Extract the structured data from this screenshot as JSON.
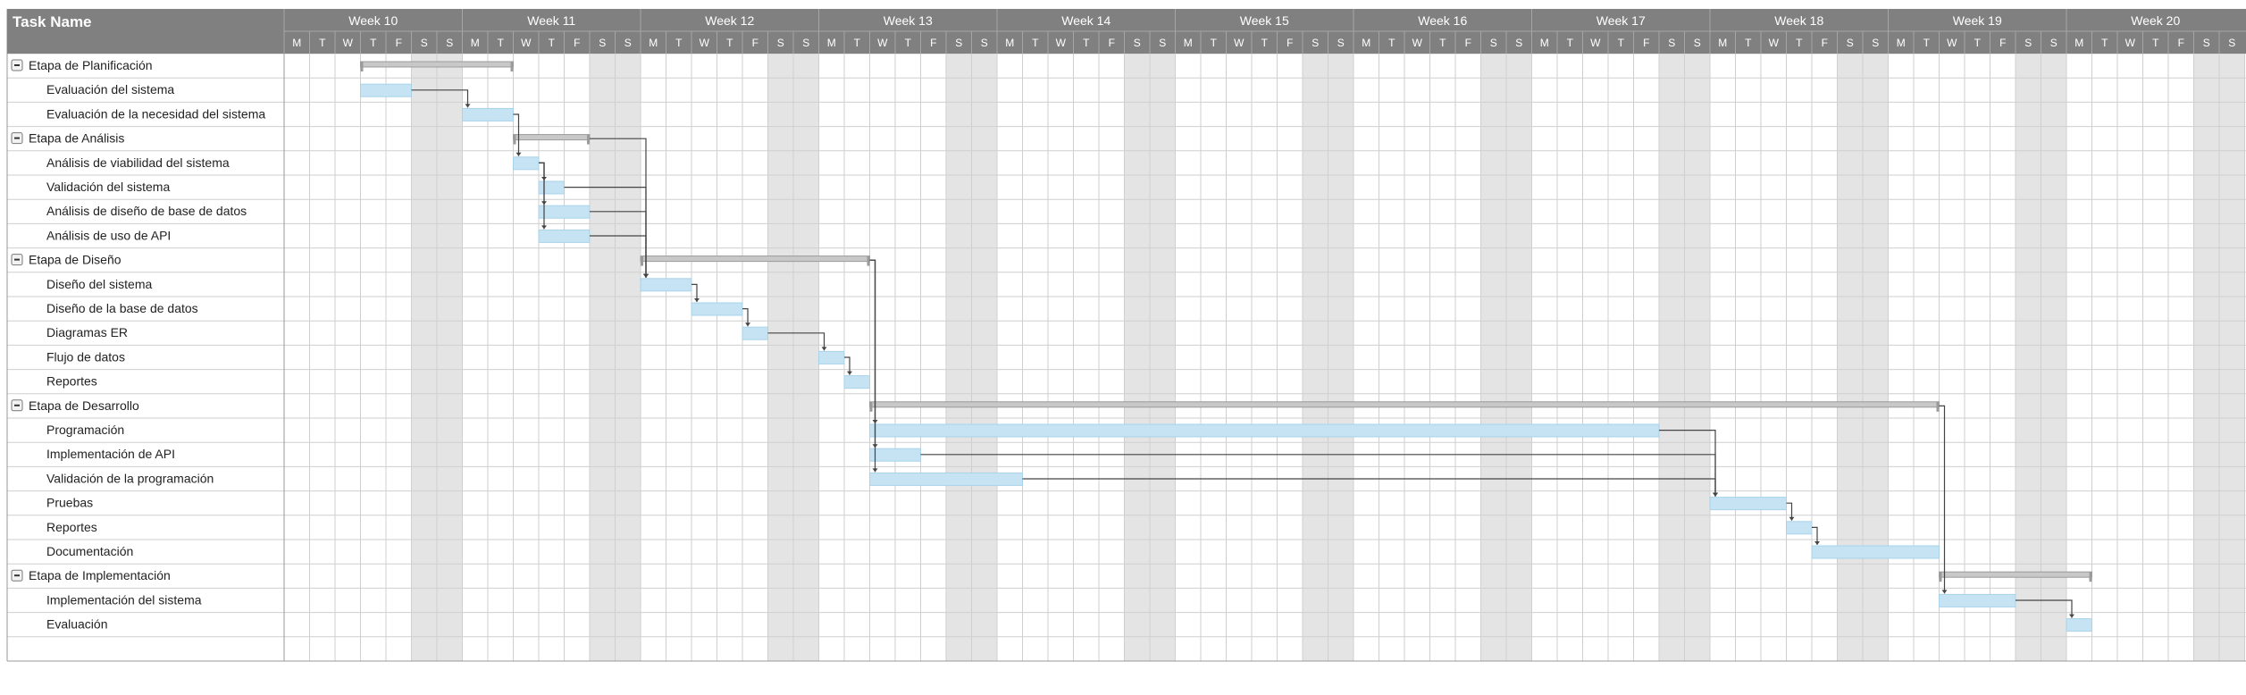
{
  "header": {
    "task_column_label": "Task Name"
  },
  "colors": {
    "header_bg": "#808080",
    "header_divider": "#a6a6a6",
    "grid_line": "#cfcfcf",
    "weekend_shade": "#e4e4e4",
    "task_bar": "#c5e3f3",
    "group_bar": "#c8c8c8",
    "dependency_line": "#444444"
  },
  "chart_data": {
    "type": "gantt",
    "weeks": [
      "Week 10",
      "Week 11",
      "Week 12",
      "Week 13",
      "Week 14",
      "Week 15",
      "Week 16",
      "Week 17",
      "Week 18",
      "Week 19",
      "Week 20"
    ],
    "day_letters": [
      "M",
      "T",
      "W",
      "T",
      "F",
      "S",
      "S"
    ],
    "weekend_days": [
      "S",
      "S"
    ],
    "unit": "day (0 = Monday of Week 10)",
    "tasks": [
      {
        "name": "Etapa de Planificación",
        "group": true,
        "start": 3,
        "end": 9
      },
      {
        "name": "Evaluación del sistema",
        "group": false,
        "start": 3,
        "end": 5
      },
      {
        "name": "Evaluación de la necesidad del sistema",
        "group": false,
        "start": 7,
        "end": 9
      },
      {
        "name": "Etapa de Análisis",
        "group": true,
        "start": 9,
        "end": 12
      },
      {
        "name": "Análisis de viabilidad del sistema",
        "group": false,
        "start": 9,
        "end": 10
      },
      {
        "name": "Validación del sistema",
        "group": false,
        "start": 10,
        "end": 11
      },
      {
        "name": "Análisis de diseño de base de datos",
        "group": false,
        "start": 10,
        "end": 12
      },
      {
        "name": "Análisis de uso de API",
        "group": false,
        "start": 10,
        "end": 12
      },
      {
        "name": "Etapa de Diseño",
        "group": true,
        "start": 14,
        "end": 23
      },
      {
        "name": "Diseño del sistema",
        "group": false,
        "start": 14,
        "end": 16
      },
      {
        "name": "Diseño de la base de datos",
        "group": false,
        "start": 16,
        "end": 18
      },
      {
        "name": "Diagramas ER",
        "group": false,
        "start": 18,
        "end": 19
      },
      {
        "name": "Flujo de datos",
        "group": false,
        "start": 21,
        "end": 22
      },
      {
        "name": "Reportes",
        "group": false,
        "start": 22,
        "end": 23
      },
      {
        "name": "Etapa de Desarrollo",
        "group": true,
        "start": 23,
        "end": 65
      },
      {
        "name": "Programación",
        "group": false,
        "start": 23,
        "end": 54
      },
      {
        "name": "Implementación de API",
        "group": false,
        "start": 23,
        "end": 25
      },
      {
        "name": "Validación de la programación",
        "group": false,
        "start": 23,
        "end": 29
      },
      {
        "name": "Pruebas",
        "group": false,
        "start": 56,
        "end": 59
      },
      {
        "name": "Reportes",
        "group": false,
        "start": 59,
        "end": 60
      },
      {
        "name": "Documentación",
        "group": false,
        "start": 60,
        "end": 65
      },
      {
        "name": "Etapa de Implementación",
        "group": true,
        "start": 65,
        "end": 71
      },
      {
        "name": "Implementación del sistema",
        "group": false,
        "start": 65,
        "end": 68
      },
      {
        "name": "Evaluación",
        "group": false,
        "start": 70,
        "end": 71
      }
    ],
    "dependencies": [
      {
        "from": 1,
        "to": 2
      },
      {
        "from": 2,
        "to": 4
      },
      {
        "from": 4,
        "to": 5
      },
      {
        "from": 4,
        "to": 6
      },
      {
        "from": 4,
        "to": 7
      },
      {
        "from": 3,
        "to": 9
      },
      {
        "from": 5,
        "to": 9
      },
      {
        "from": 6,
        "to": 9
      },
      {
        "from": 7,
        "to": 9
      },
      {
        "from": 9,
        "to": 10
      },
      {
        "from": 10,
        "to": 11
      },
      {
        "from": 11,
        "to": 12
      },
      {
        "from": 12,
        "to": 13
      },
      {
        "from": 8,
        "to": 15
      },
      {
        "from": 8,
        "to": 16
      },
      {
        "from": 8,
        "to": 17
      },
      {
        "from": 15,
        "to": 18
      },
      {
        "from": 16,
        "to": 18
      },
      {
        "from": 17,
        "to": 18
      },
      {
        "from": 18,
        "to": 19
      },
      {
        "from": 19,
        "to": 20
      },
      {
        "from": 14,
        "to": 22
      },
      {
        "from": 22,
        "to": 23
      }
    ]
  }
}
